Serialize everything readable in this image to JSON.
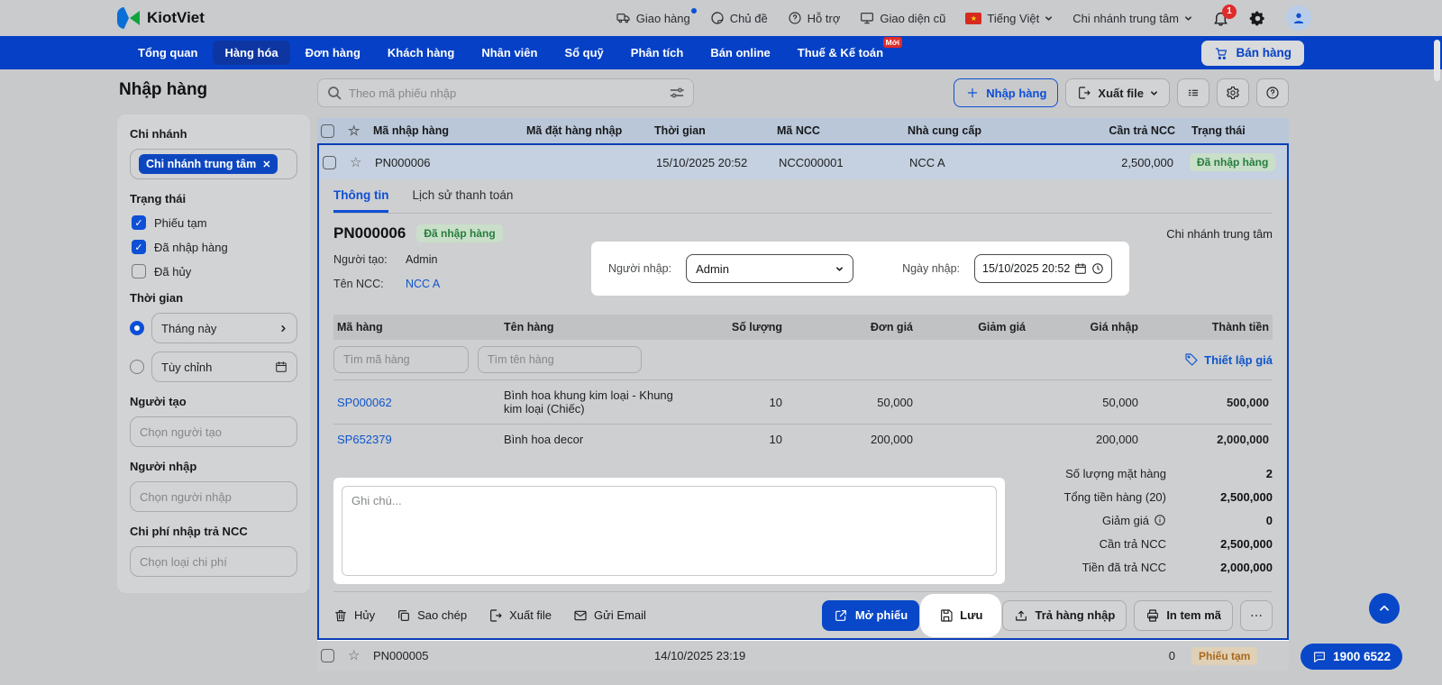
{
  "topbar": {
    "brand": "KiotViet",
    "delivery": "Giao hàng",
    "theme": "Chủ đề",
    "support": "Hỗ trợ",
    "legacy_ui": "Giao diện cũ",
    "language": "Tiếng Việt",
    "branch": "Chi nhánh trung tâm",
    "notification_count": "1"
  },
  "nav": {
    "items": [
      {
        "label": "Tổng quan"
      },
      {
        "label": "Hàng hóa"
      },
      {
        "label": "Đơn hàng"
      },
      {
        "label": "Khách hàng"
      },
      {
        "label": "Nhân viên"
      },
      {
        "label": "Sổ quỹ"
      },
      {
        "label": "Phân tích"
      },
      {
        "label": "Bán online"
      },
      {
        "label": "Thuế & Kế toán"
      }
    ],
    "new_badge": "Mới",
    "sell_button": "Bán hàng"
  },
  "sidebar": {
    "title": "Nhập hàng",
    "branch": {
      "label": "Chi nhánh",
      "chip": "Chi nhánh trung tâm"
    },
    "status": {
      "label": "Trạng thái",
      "options": [
        {
          "label": "Phiếu tạm",
          "checked": true
        },
        {
          "label": "Đã nhập hàng",
          "checked": true
        },
        {
          "label": "Đã hủy",
          "checked": false
        }
      ]
    },
    "time": {
      "label": "Thời gian",
      "preset": {
        "label": "Tháng này",
        "selected": true
      },
      "custom": {
        "label": "Tùy chỉnh",
        "selected": false
      }
    },
    "creator": {
      "label": "Người tạo",
      "placeholder": "Chọn người tạo"
    },
    "importer": {
      "label": "Người nhập",
      "placeholder": "Chọn người nhập"
    },
    "cost": {
      "label": "Chi phí nhập trả NCC",
      "placeholder": "Chọn loại chi phí"
    }
  },
  "toolbar": {
    "search_placeholder": "Theo mã phiếu nhập",
    "import_label": "Nhập hàng",
    "export_label": "Xuất file"
  },
  "table": {
    "headers": [
      "Mã nhập hàng",
      "Mã đặt hàng nhập",
      "Thời gian",
      "Mã NCC",
      "Nhà cung cấp",
      "Cần trả NCC",
      "Trạng thái"
    ],
    "row_top": {
      "code": "PN000006",
      "order_code": "",
      "time": "15/10/2025 20:52",
      "ncc_code": "NCC000001",
      "supplier": "NCC A",
      "amount": "2,500,000",
      "status": "Đã nhập hàng"
    },
    "row_bottom": {
      "code": "PN000005",
      "order_code": "",
      "time": "14/10/2025 23:19",
      "ncc_code": "",
      "supplier": "",
      "amount": "0",
      "status": "Phiếu tạm"
    }
  },
  "detail": {
    "tab_info": "Thông tin",
    "tab_history": "Lịch sử thanh toán",
    "code": "PN000006",
    "status": "Đã nhập hàng",
    "branch": "Chi nhánh trung tâm",
    "creator_label": "Người tạo:",
    "creator": "Admin",
    "supplier_label": "Tên NCC:",
    "supplier": "NCC A",
    "importer_label": "Người nhập:",
    "importer": "Admin",
    "date_label": "Ngày nhập:",
    "date": "15/10/2025 20:52",
    "products": {
      "headers": [
        "Mã hàng",
        "Tên hàng",
        "Số lượng",
        "Đơn giá",
        "Giảm giá",
        "Giá nhập",
        "Thành tiền"
      ],
      "code_placeholder": "Tìm mã hàng",
      "name_placeholder": "Tìm tên hàng",
      "price_setup": "Thiết lập giá",
      "rows": [
        {
          "code": "SP000062",
          "name": "Bình hoa khung kim loại - Khung kim loại (Chiếc)",
          "qty": "10",
          "price": "50,000",
          "discount": "",
          "import_price": "50,000",
          "total": "500,000"
        },
        {
          "code": "SP652379",
          "name": "Bình hoa decor",
          "qty": "10",
          "price": "200,000",
          "discount": "",
          "import_price": "200,000",
          "total": "2,000,000"
        }
      ]
    },
    "note_placeholder": "Ghi chú...",
    "summary": [
      {
        "label": "Số lượng mặt hàng",
        "value": "2"
      },
      {
        "label": "Tổng tiền hàng (20)",
        "value": "2,500,000"
      },
      {
        "label": "Giảm giá",
        "value": "0"
      },
      {
        "label": "Cần trả NCC",
        "value": "2,500,000"
      },
      {
        "label": "Tiền đã trả NCC",
        "value": "2,000,000"
      }
    ],
    "actions": {
      "cancel": "Hủy",
      "copy": "Sao chép",
      "export": "Xuất file",
      "email": "Gửi Email",
      "open": "Mở phiếu",
      "save": "Lưu",
      "return": "Trả hàng nhập",
      "print": "In tem mã"
    }
  },
  "floating": {
    "hotline": "1900 6522"
  }
}
